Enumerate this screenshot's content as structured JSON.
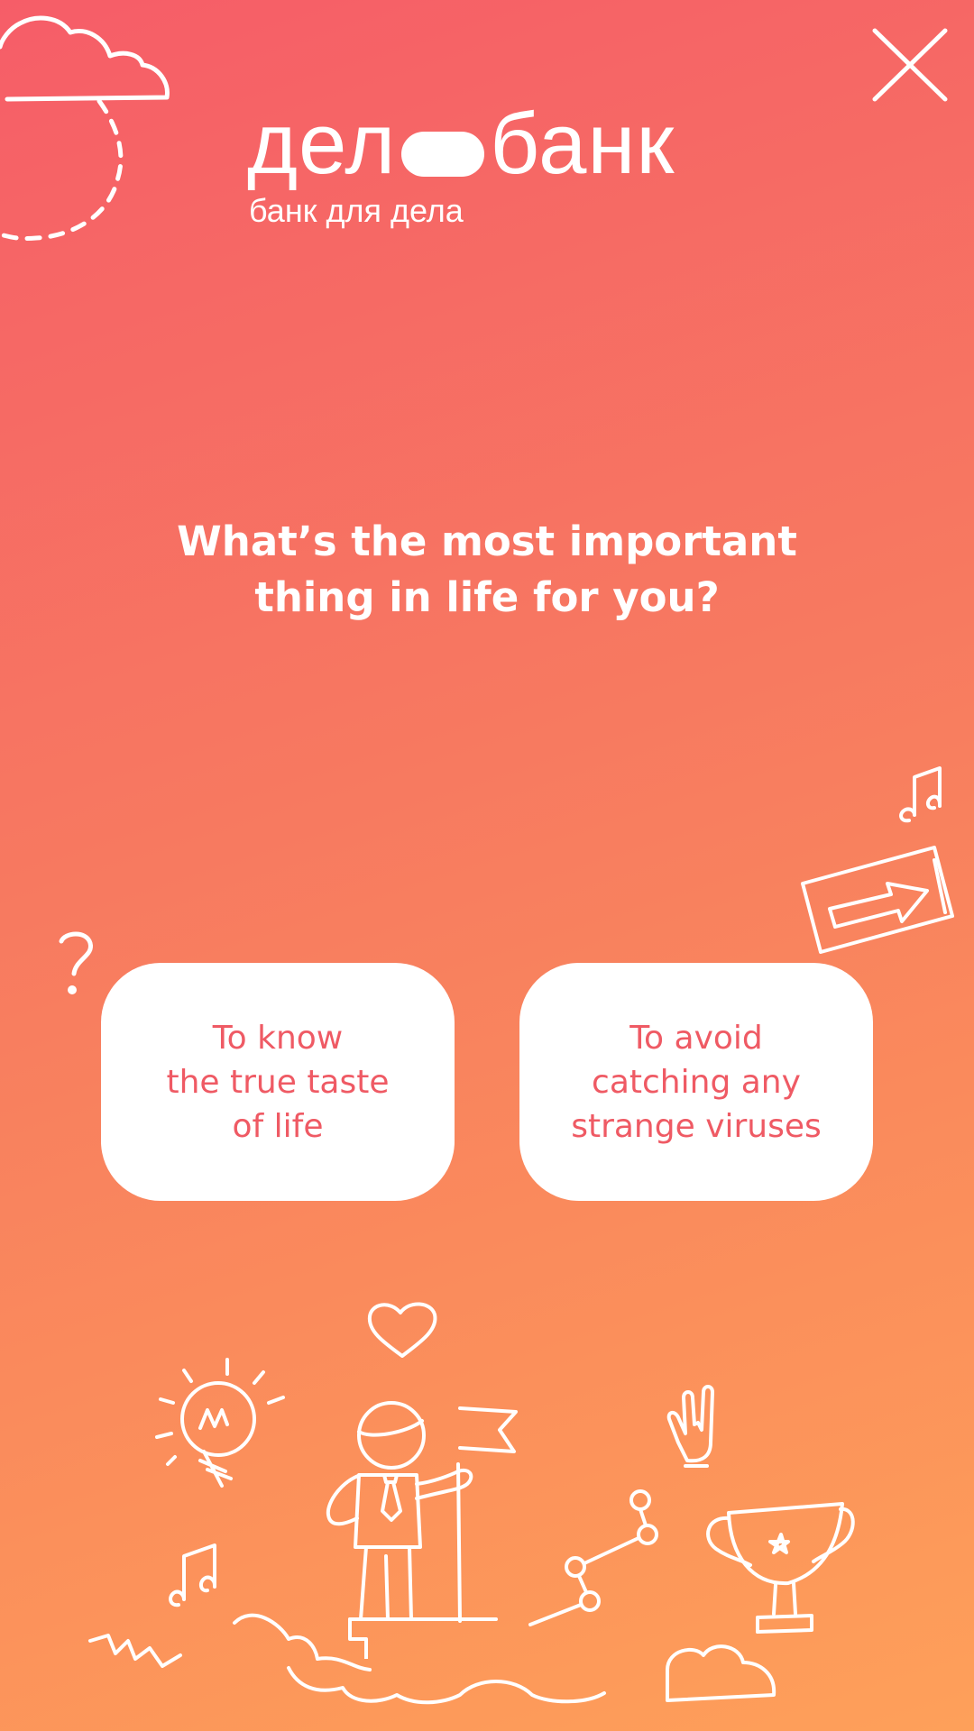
{
  "header": {
    "close_icon": "close-icon",
    "logo_left": "дел",
    "logo_right": "банк",
    "tagline": "банк для дела"
  },
  "quiz": {
    "question": "What’s the most important\nthing in life for you?",
    "answers": [
      {
        "label": "To know\nthe true taste\nof life"
      },
      {
        "label": "To avoid\ncatching any\nstrange viruses"
      }
    ]
  },
  "decor": {
    "icons": [
      "cloud-icon",
      "music-note-icon",
      "arrow-sign-icon",
      "question-mark-icon",
      "heart-icon",
      "lightbulb-icon",
      "person-with-flag-icon",
      "rock-hand-icon",
      "trophy-icon",
      "graph-icon",
      "clouds-ground-icon"
    ]
  },
  "colors": {
    "gradient_top": "#f65d68",
    "gradient_bottom": "#fea05a",
    "button_background": "#ffffff",
    "button_text": "#ef5a64",
    "foreground": "#ffffff"
  }
}
